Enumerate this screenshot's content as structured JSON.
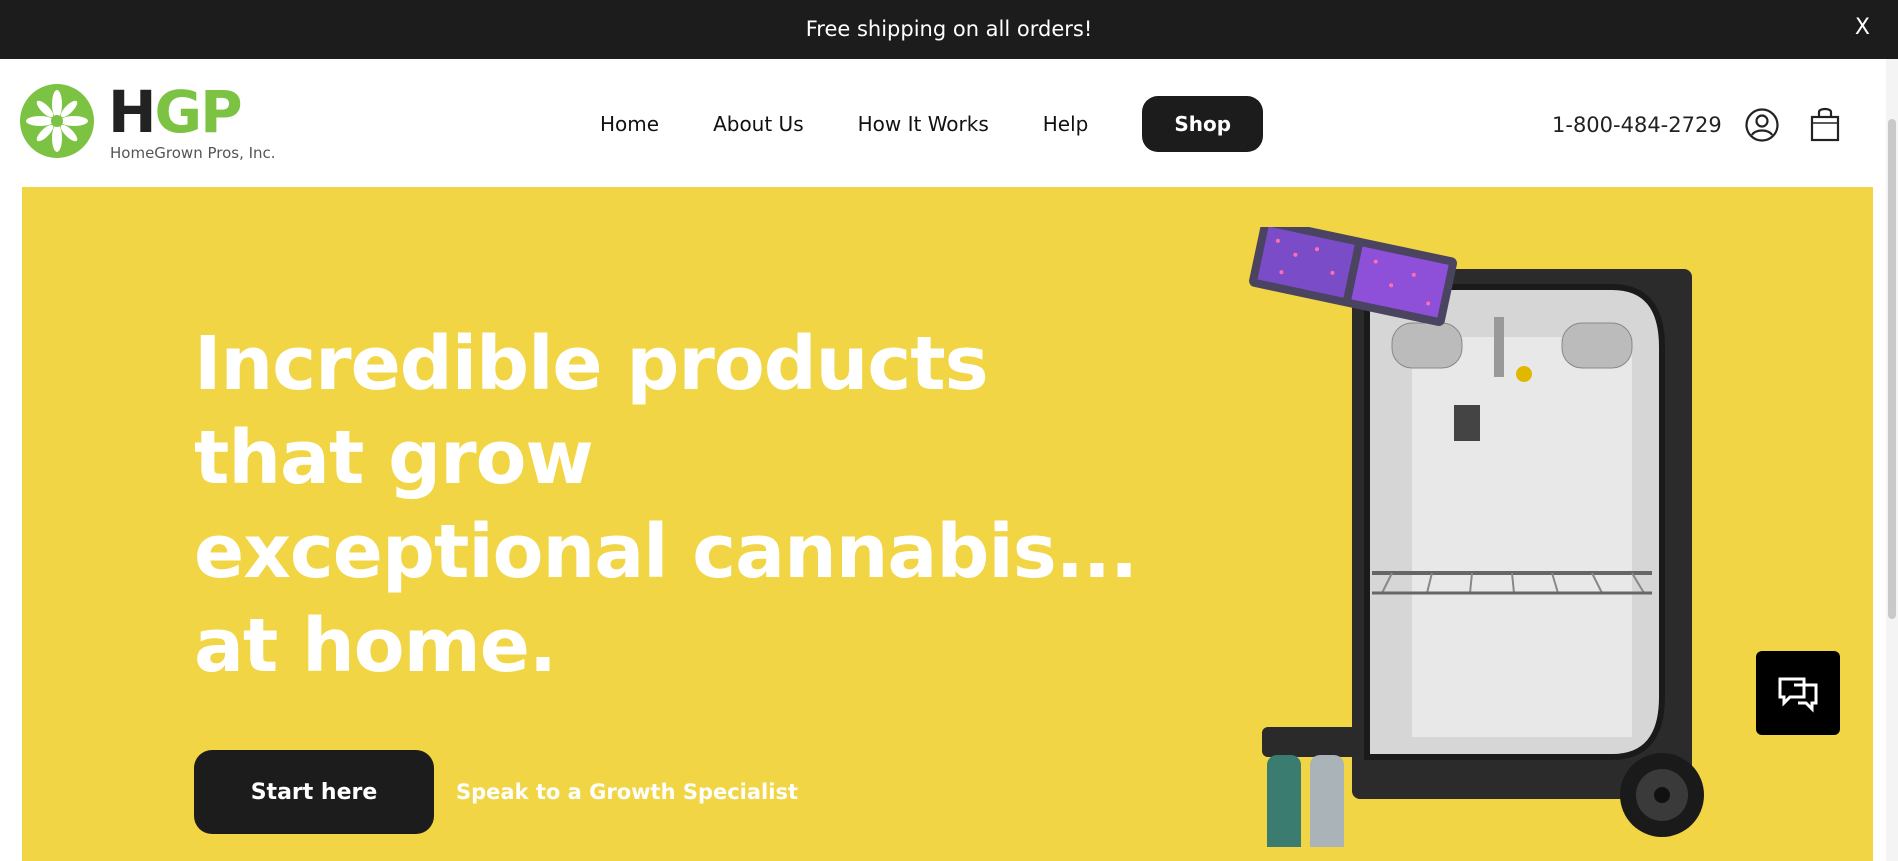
{
  "announcement": {
    "text": "Free shipping on all orders!",
    "close_label": "X"
  },
  "logo": {
    "letters_h": "H",
    "letters_gp": "GP",
    "subtitle": "HomeGrown Pros, Inc."
  },
  "nav": {
    "items": [
      {
        "label": "Home"
      },
      {
        "label": "About Us"
      },
      {
        "label": "How It Works"
      },
      {
        "label": "Help"
      }
    ],
    "shop_label": "Shop"
  },
  "header": {
    "phone": "1-800-484-2729",
    "account_icon": "user-circle-icon",
    "cart_icon": "shopping-bag-icon"
  },
  "hero": {
    "title_lines": [
      "Incredible products",
      "that grow",
      "exceptional cannabis...",
      "at home."
    ],
    "cta_label": "Start here",
    "secondary_link": "Speak to a Growth Specialist",
    "background_color": "#f1d544",
    "image": "grow-tent-kit-image"
  },
  "chat": {
    "icon": "chat-bubbles-icon"
  },
  "colors": {
    "brand_green": "#7cc243",
    "dark": "#1c1c1c",
    "hero_yellow": "#f1d544"
  }
}
